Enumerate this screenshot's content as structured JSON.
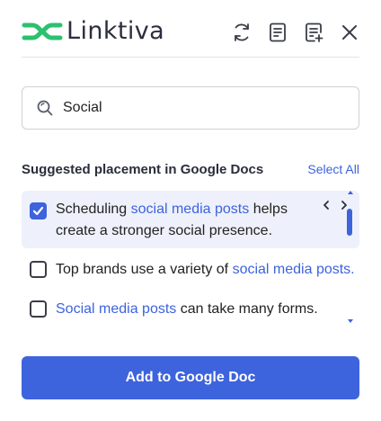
{
  "brand": {
    "name": "Linktiva",
    "accent": "#2bc16f",
    "text_color": "#2c2e3e"
  },
  "header": {
    "icons": [
      "refresh-icon",
      "document-icon",
      "document-add-icon",
      "close-icon"
    ]
  },
  "search": {
    "value": "Social",
    "icon": "search-icon"
  },
  "suggestions": {
    "title": "Suggested placement in Google Docs",
    "select_all_label": "Select All",
    "items": [
      {
        "checked": true,
        "before": "Scheduling ",
        "highlight": "social media posts",
        "after": " helps create a stronger social presence."
      },
      {
        "checked": false,
        "before": "Top brands use a variety of ",
        "highlight": "social media posts.",
        "after": ""
      },
      {
        "checked": false,
        "before": "",
        "highlight": "Social media posts",
        "after": " can take many forms."
      }
    ]
  },
  "primary_button": {
    "label": "Add to Google Doc",
    "color": "#3d63dd"
  }
}
